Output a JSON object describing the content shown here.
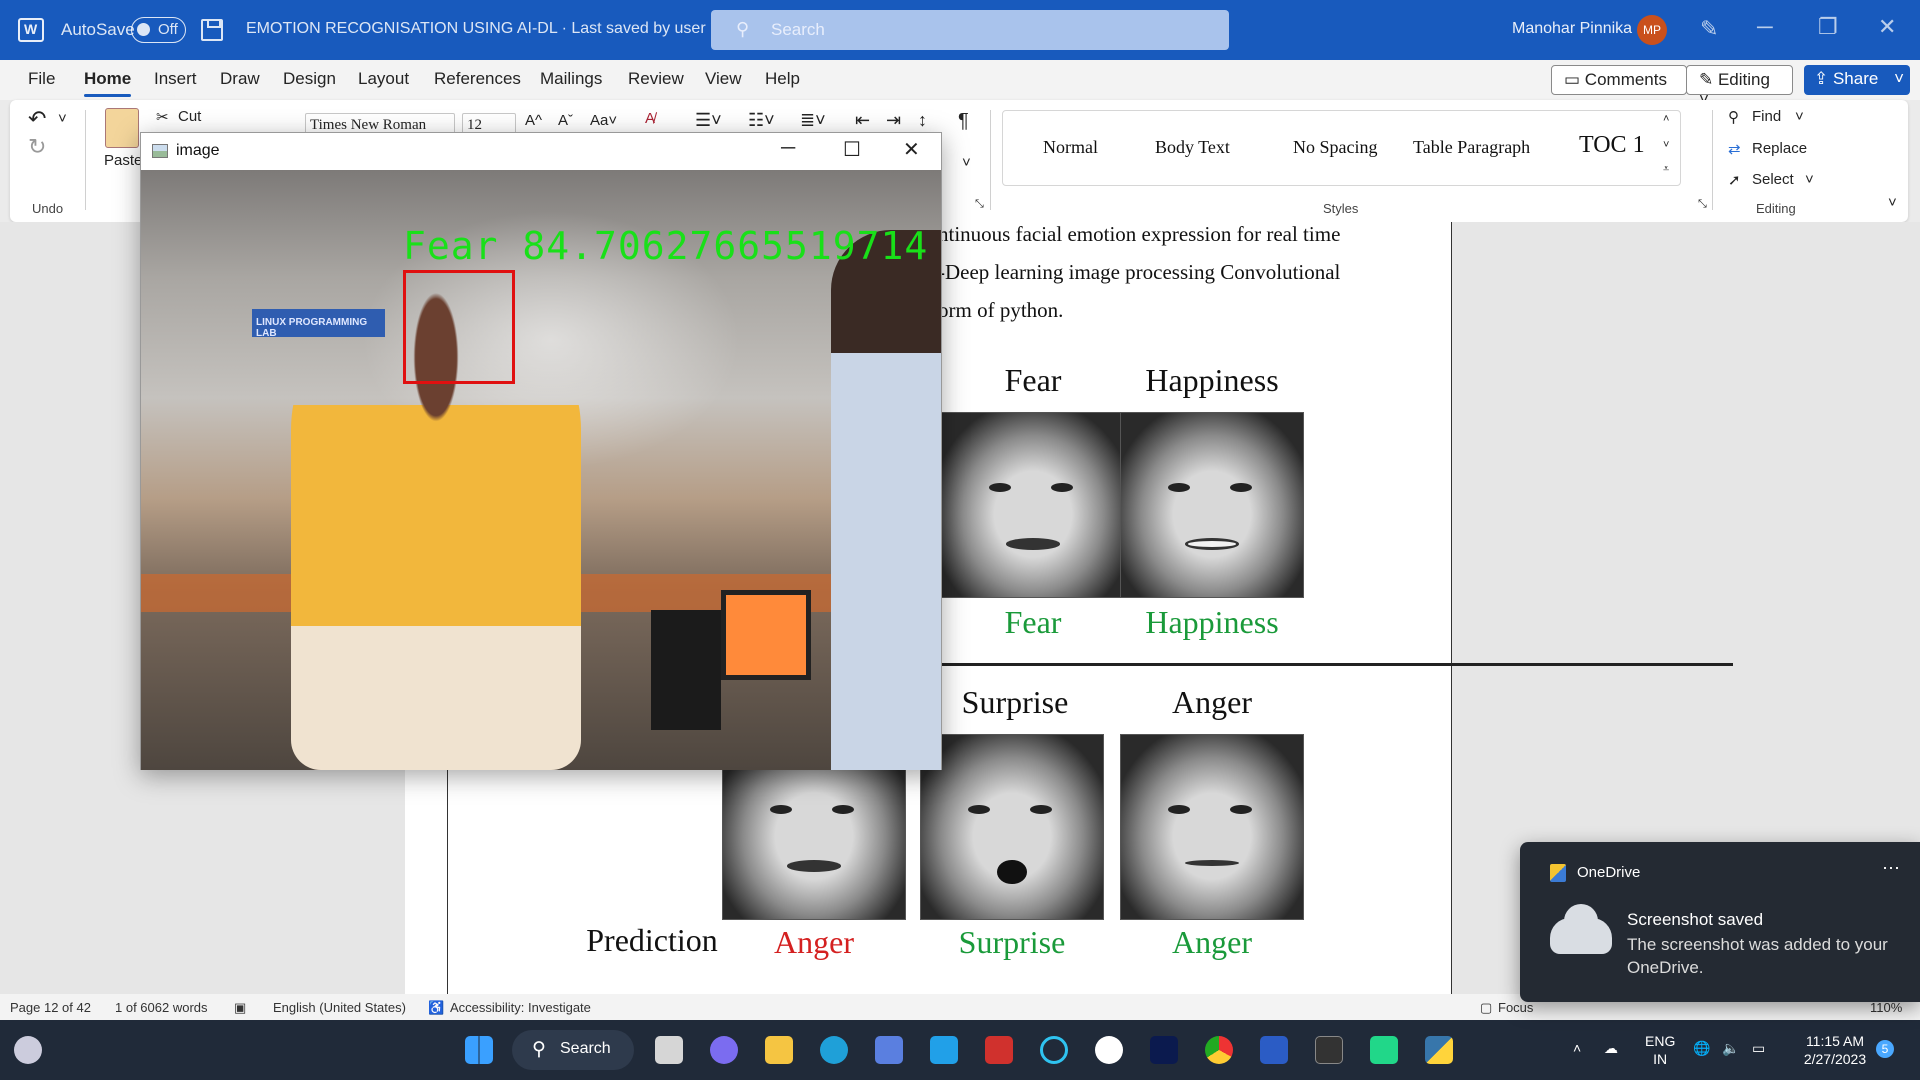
{
  "titlebar": {
    "autosave_label": "AutoSave",
    "autosave_state": "Off",
    "doc_title": "EMOTION RECOGNISATION USING AI-DL  ·  Last saved by user ˅",
    "search_placeholder": "Search",
    "username": "Manohar Pinnika",
    "avatar_initials": "MP"
  },
  "menu": {
    "items": [
      "File",
      "Home",
      "Insert",
      "Draw",
      "Design",
      "Layout",
      "References",
      "Mailings",
      "Review",
      "View",
      "Help"
    ],
    "active": "Home",
    "comments": "Comments",
    "editing": "Editing ˅",
    "share": "Share"
  },
  "ribbon": {
    "undo_group": "Undo",
    "paste": "Paste",
    "cut": "Cut",
    "font_name": "Times New Roman",
    "font_size": "12",
    "styles": [
      "Normal",
      "Body Text",
      "No Spacing",
      "Table Paragraph",
      "TOC 1"
    ],
    "styles_group": "Styles",
    "find": "Find",
    "replace": "Replace",
    "select": "Select",
    "editing_group": "Editing"
  },
  "document": {
    "lines": [
      "ntinuous facial emotion expression for real time",
      "-Deep learning image processing Convolutional",
      "orm of python."
    ],
    "figure": {
      "row1_labels": [
        "Fear",
        "Happiness"
      ],
      "row1_preds": [
        "Fear",
        "Happiness"
      ],
      "row2_labels": [
        "Surprise",
        "Anger"
      ],
      "row2_preds": [
        "Anger",
        "Surprise",
        "Anger"
      ],
      "prediction_label": "Prediction"
    },
    "colors": {
      "correct": "#1a9a3a",
      "wrong": "#d42020"
    }
  },
  "image_window": {
    "title": "image",
    "prediction": "Fear  84.70627665519714",
    "sign_text": "LINUX PROGRAMMING LAB"
  },
  "statusbar": {
    "page": "Page 12 of 42",
    "words": "1 of 6062 words",
    "language": "English (United States)",
    "accessibility": "Accessibility: Investigate",
    "focus": "Focus",
    "zoom": "110%"
  },
  "taskbar": {
    "search": "Search",
    "lang_top": "ENG",
    "lang_bottom": "IN",
    "time": "11:15 AM",
    "date": "2/27/2023",
    "badge": "5"
  },
  "toast": {
    "app": "OneDrive",
    "heading": "Screenshot saved",
    "body": "The screenshot was added to your OneDrive."
  }
}
